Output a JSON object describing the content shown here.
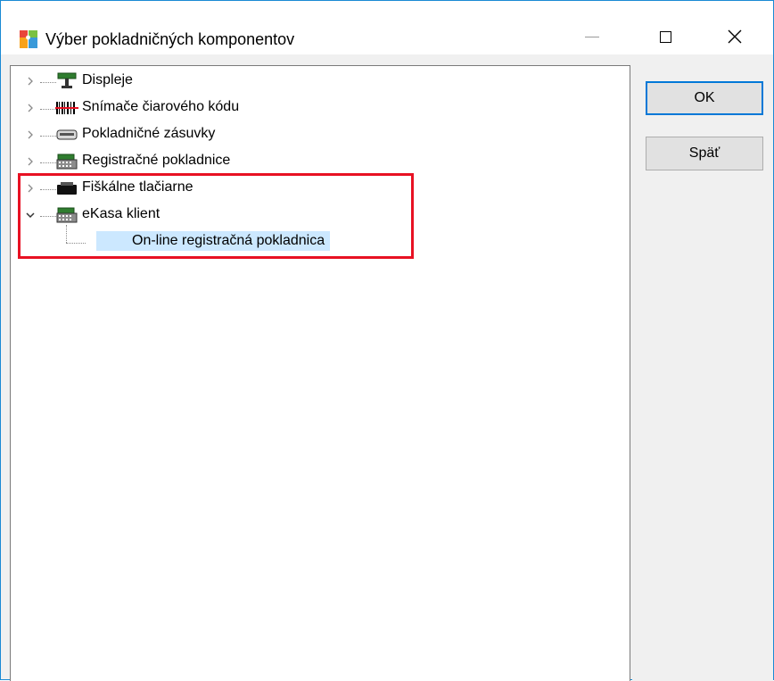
{
  "window": {
    "title": "Výber pokladničných komponentov",
    "icon": "app-puzzle-icon"
  },
  "titlebar_buttons": {
    "minimize": "minimize-icon",
    "maximize": "maximize-icon",
    "close_glyph": "✕"
  },
  "tree": {
    "items": [
      {
        "label": "Displeje",
        "icon": "display-icon",
        "expanded": false
      },
      {
        "label": "Snímače čiarového kódu",
        "icon": "barcode-scanner-icon",
        "expanded": false
      },
      {
        "label": "Pokladničné zásuvky",
        "icon": "cash-drawer-icon",
        "expanded": false
      },
      {
        "label": "Registračné pokladnice",
        "icon": "cash-register-icon",
        "expanded": false
      },
      {
        "label": "Fiškálne tlačiarne",
        "icon": "fiscal-printer-icon",
        "expanded": false
      },
      {
        "label": "eKasa klient",
        "icon": "cash-register-icon",
        "expanded": true,
        "children": [
          {
            "label": "On-line registračná pokladnica",
            "selected": true
          }
        ]
      }
    ]
  },
  "buttons": {
    "ok": "OK",
    "back": "Späť"
  },
  "colors": {
    "accent": "#0078d7",
    "selection": "#cce8ff",
    "highlight": "#e81123"
  }
}
